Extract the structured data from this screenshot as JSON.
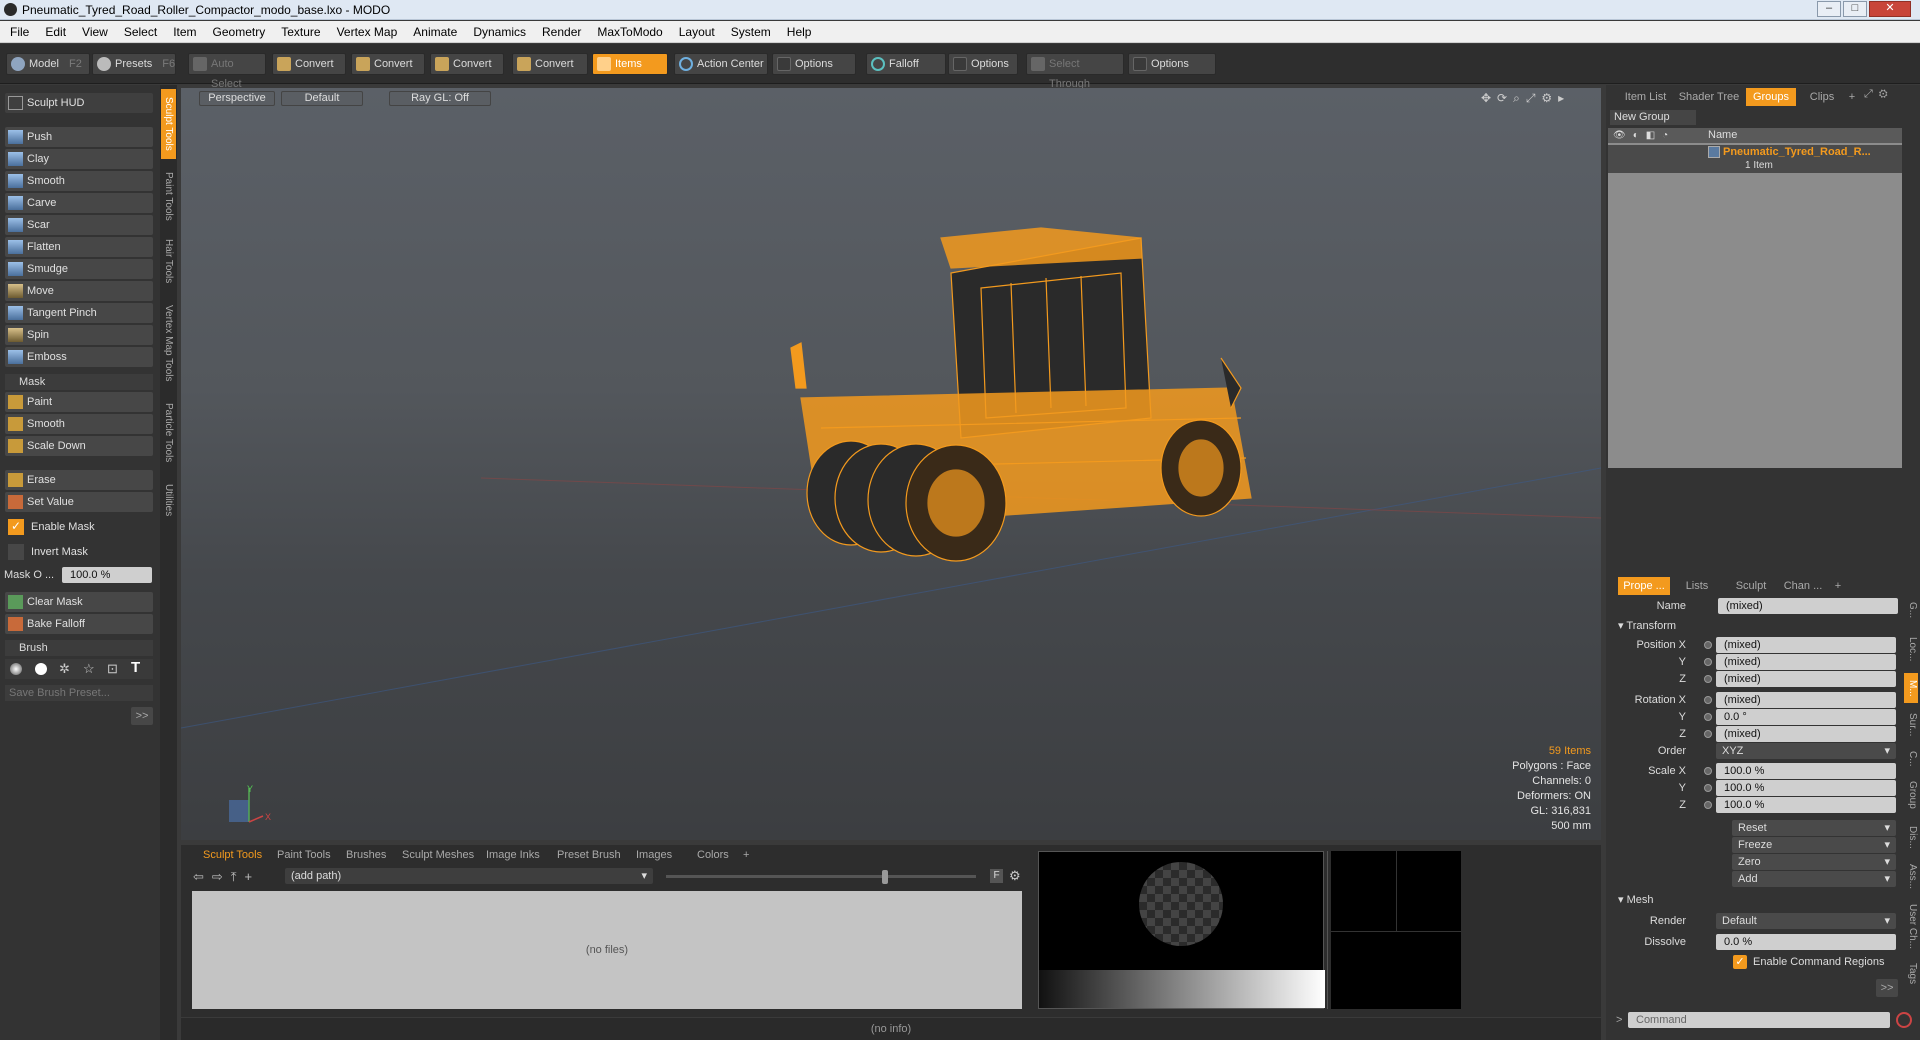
{
  "window": {
    "title": "Pneumatic_Tyred_Road_Roller_Compactor_modo_base.lxo - MODO"
  },
  "menu": [
    "File",
    "Edit",
    "View",
    "Select",
    "Item",
    "Geometry",
    "Texture",
    "Vertex Map",
    "Animate",
    "Dynamics",
    "Render",
    "MaxToModo",
    "Layout",
    "System",
    "Help"
  ],
  "toolbar": {
    "model": "Model",
    "model_key": "F2",
    "presets": "Presets",
    "presets_key": "F6",
    "auto_select": "Auto Select",
    "convert1": "Convert",
    "convert2": "Convert",
    "convert3": "Convert",
    "convert4": "Convert",
    "items": "Items",
    "action_center": "Action Center",
    "options1": "Options",
    "falloff": "Falloff",
    "options2": "Options",
    "select_through": "Select Through",
    "options3": "Options"
  },
  "left": {
    "sculpt_hud": "Sculpt HUD",
    "tools": [
      "Push",
      "Clay",
      "Smooth",
      "Carve",
      "Scar",
      "Flatten",
      "Smudge",
      "Move",
      "Tangent Pinch",
      "Spin",
      "Emboss"
    ],
    "mask_header": "Mask",
    "mask_tools": [
      "Paint",
      "Smooth",
      "Scale Down"
    ],
    "erase": "Erase",
    "set_value": "Set Value",
    "enable_mask": "Enable Mask",
    "invert_mask": "Invert Mask",
    "mask_opacity_label": "Mask O ...",
    "mask_opacity_value": "100.0 %",
    "clear_mask": "Clear Mask",
    "bake_falloff": "Bake Falloff",
    "brush_header": "Brush",
    "save_brush_preset": "Save Brush Preset...",
    "expand": ">>"
  },
  "vtabs": [
    "Sculpt Tools",
    "Paint Tools",
    "Hair Tools",
    "Vertex Map Tools",
    "Particle Tools",
    "Utilities"
  ],
  "viewport": {
    "perspective": "Perspective",
    "default": "Default",
    "raygl": "Ray GL: Off",
    "axis_y": "Y",
    "axis_x": "X",
    "stats": {
      "items": "59 Items",
      "polygons": "Polygons : Face",
      "channels": "Channels: 0",
      "deformers": "Deformers: ON",
      "gl": "GL: 316,831",
      "scale": "500 mm"
    }
  },
  "bottom": {
    "tabs": [
      "Sculpt Tools",
      "Paint Tools",
      "Brushes",
      "Sculpt Meshes",
      "Image Inks",
      "Preset Brush",
      "Images",
      "Colors",
      "+"
    ],
    "path": "(add path)",
    "f_label": "F",
    "no_files": "(no files)",
    "status": "(no info)"
  },
  "right": {
    "top_tabs": [
      "Item List",
      "Shader Tree",
      "Groups",
      "Clips",
      "+"
    ],
    "new_group": "New Group",
    "name_col": "Name",
    "group_name": "Pneumatic_Tyred_Road_R...",
    "group_count": "1 Item",
    "prop_tabs": [
      "Prope ...",
      "Lists",
      "Sculpt",
      "Chan ...",
      "+"
    ],
    "name_label": "Name",
    "name_value": "(mixed)",
    "transform": "Transform",
    "pos_x_label": "Position X",
    "pos_x": "(mixed)",
    "pos_y_label": "Y",
    "pos_y": "(mixed)",
    "pos_z_label": "Z",
    "pos_z": "(mixed)",
    "rot_x_label": "Rotation X",
    "rot_x": "(mixed)",
    "rot_y_label": "Y",
    "rot_y": "0.0 °",
    "rot_z_label": "Z",
    "rot_z": "(mixed)",
    "order_label": "Order",
    "order": "XYZ",
    "scale_x_label": "Scale X",
    "scale_x": "100.0 %",
    "scale_y_label": "Y",
    "scale_y": "100.0 %",
    "scale_z_label": "Z",
    "scale_z": "100.0 %",
    "reset": "Reset",
    "freeze": "Freeze",
    "zero": "Zero",
    "add": "Add",
    "mesh": "Mesh",
    "render_label": "Render",
    "render": "Default",
    "dissolve_label": "Dissolve",
    "dissolve": "0.0 %",
    "enable_cmd_regions": "Enable Command Regions",
    "expand": ">>",
    "command": "Command",
    "side_tabs": [
      "G...",
      "Loc...",
      "M...",
      "Sur...",
      "C...",
      "Group",
      "Dis...",
      "Ass...",
      "User Ch...",
      "Tags"
    ]
  },
  "colors": {
    "accent": "#f39a1e"
  }
}
